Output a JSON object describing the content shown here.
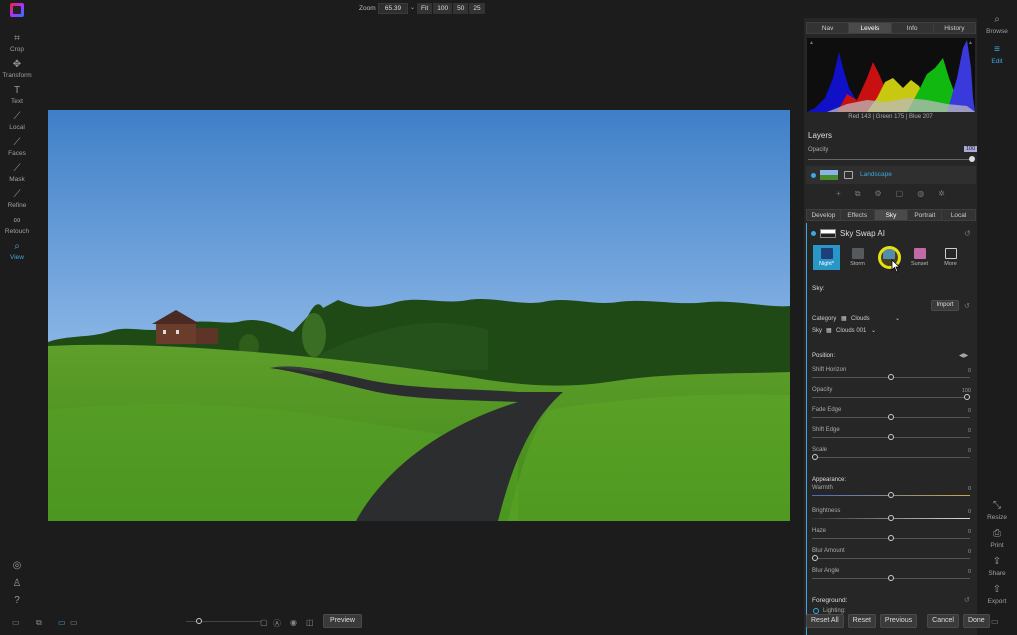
{
  "left_tools": [
    {
      "label": "Crop",
      "icon": "crop-icon",
      "glyph": "⌗",
      "active": false
    },
    {
      "label": "Transform",
      "icon": "move-icon",
      "glyph": "✥",
      "active": false
    },
    {
      "label": "Text",
      "icon": "text-icon",
      "glyph": "T",
      "active": false
    },
    {
      "label": "Local",
      "icon": "brush-icon",
      "glyph": "⟋",
      "active": false
    },
    {
      "label": "Faces",
      "icon": "face-brush-icon",
      "glyph": "⟋",
      "active": false
    },
    {
      "label": "Mask",
      "icon": "mask-brush-icon",
      "glyph": "⟋",
      "active": false
    },
    {
      "label": "Refine",
      "icon": "refine-brush-icon",
      "glyph": "⟋",
      "active": false
    },
    {
      "label": "Retouch",
      "icon": "retouch-icon",
      "glyph": "∞",
      "active": false
    },
    {
      "label": "View",
      "icon": "magnifier-icon",
      "glyph": "⌕",
      "active": true
    }
  ],
  "topbar": {
    "zoom_label": "Zoom",
    "zoom_value": "65.39",
    "zoom_presets": [
      "Fit",
      "100",
      "50",
      "25"
    ]
  },
  "bottombar": {
    "preview_label": "Preview"
  },
  "right_panel": {
    "top_tabs": [
      {
        "label": "Nav",
        "active": false
      },
      {
        "label": "Levels",
        "active": true
      },
      {
        "label": "Info",
        "active": false
      },
      {
        "label": "History",
        "active": false
      }
    ],
    "rgb_readout": "Red 143 | Green 175 | Blue 207",
    "layers_title": "Layers",
    "opacity_label": "Opacity",
    "opacity_value": "100",
    "layer_name": "Landscape",
    "module_tabs": [
      {
        "label": "Develop",
        "active": false
      },
      {
        "label": "Effects",
        "active": false
      },
      {
        "label": "Sky",
        "active": true
      },
      {
        "label": "Portrait",
        "active": false
      },
      {
        "label": "Local",
        "active": false
      }
    ],
    "sky_title": "Sky Swap AI",
    "presets": [
      {
        "label": "Night*",
        "selected": true,
        "color": "#1d3f7a"
      },
      {
        "label": "Storm",
        "selected": false,
        "color": "#555a5e"
      },
      {
        "label": "",
        "selected": false,
        "color": "#3a7fc8"
      },
      {
        "label": "Sunset",
        "selected": false,
        "color": "#c26aa8"
      },
      {
        "label": "More",
        "selected": false,
        "color": "#262626"
      }
    ],
    "sky_section": "Sky:",
    "import_label": "Import",
    "category_label": "Category",
    "category_value": "Clouds",
    "sky_label": "Sky",
    "sky_value": "Clouds 001",
    "position_section": "Position:",
    "appearance_section": "Appearance:",
    "foreground_section": "Foreground:",
    "lighting_label": "Lighting:",
    "sliders": [
      {
        "label": "Shift Horizon",
        "value": "0",
        "pos": 0.5
      },
      {
        "label": "Opacity",
        "value": "100",
        "pos": 1.0
      },
      {
        "label": "Fade Edge",
        "value": "0",
        "pos": 0.5
      },
      {
        "label": "Shift Edge",
        "value": "0",
        "pos": 0.5
      },
      {
        "label": "Scale",
        "value": "0",
        "pos": 0.0
      },
      {
        "label": "Warmth",
        "value": "0",
        "pos": 0.5
      },
      {
        "label": "Brightness",
        "value": "0",
        "pos": 0.5
      },
      {
        "label": "Haze",
        "value": "0",
        "pos": 0.5
      },
      {
        "label": "Blur Amount",
        "value": "0",
        "pos": 0.0
      },
      {
        "label": "Blur Angle",
        "value": "0",
        "pos": 0.5
      }
    ]
  },
  "right_nav": [
    {
      "label": "Browse",
      "icon": "browse-icon",
      "glyph": "⌕",
      "active": false
    },
    {
      "label": "Edit",
      "icon": "sliders-icon",
      "glyph": "≡",
      "active": true
    },
    {
      "label": "Resize",
      "icon": "resize-icon",
      "glyph": "⤡",
      "active": false
    },
    {
      "label": "Print",
      "icon": "print-icon",
      "glyph": "⎙",
      "active": false
    },
    {
      "label": "Share",
      "icon": "share-icon",
      "glyph": "⇪",
      "active": false
    },
    {
      "label": "Export",
      "icon": "export-icon",
      "glyph": "⇧",
      "active": false
    }
  ],
  "footer_buttons": [
    "Reset All",
    "Reset",
    "Previous",
    "Cancel",
    "Done"
  ]
}
